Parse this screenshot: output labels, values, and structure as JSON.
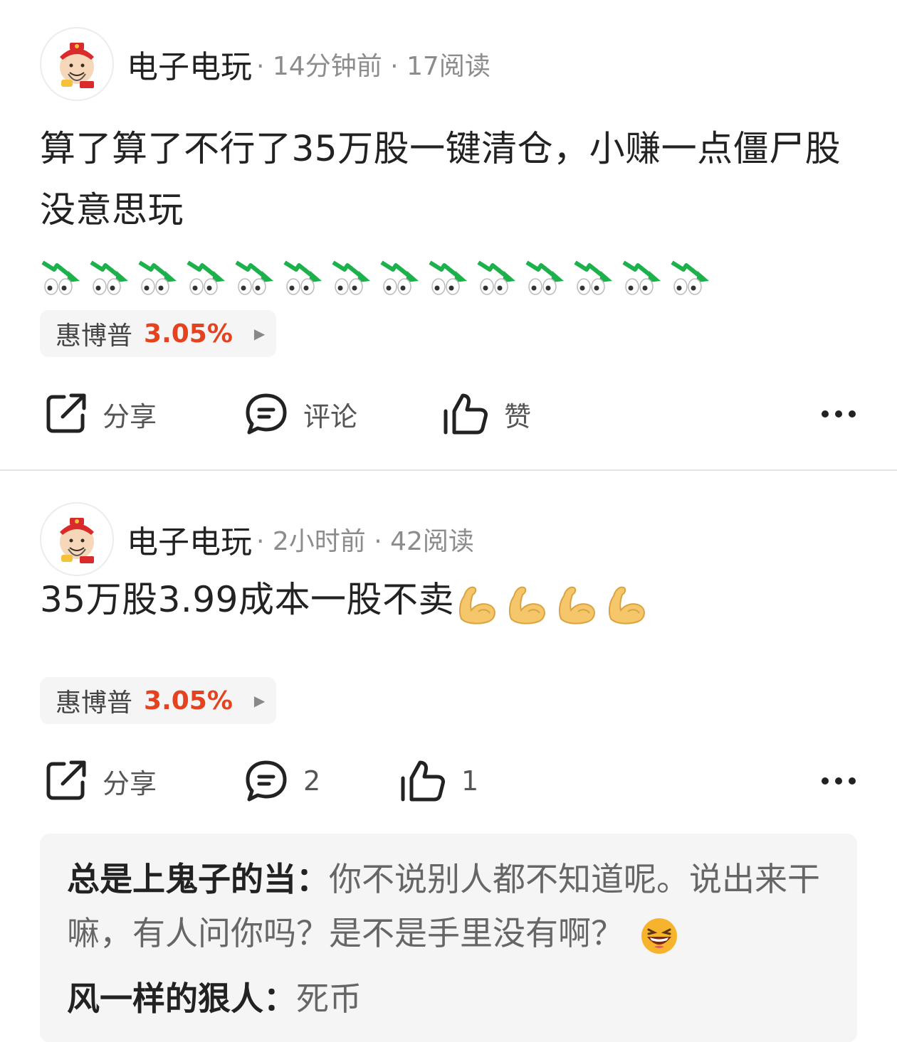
{
  "posts": [
    {
      "author": "电子电玩",
      "meta": "· 14分钟前 · 17阅读",
      "text": "算了算了不行了35万股一键清仓，小赚一点僵尸股没意思玩",
      "emoji_name": "falling-chart-eyes-emoji",
      "emoji_count": 14,
      "stock": {
        "name": "惠博普",
        "change": "3.05%"
      },
      "actions": {
        "share": "分享",
        "comment": "评论",
        "like": "赞"
      }
    },
    {
      "author": "电子电玩",
      "meta": "· 2小时前 · 42阅读",
      "text": "35万股3.99成本一股不卖",
      "emoji_name": "flexed-biceps-emoji",
      "emoji_count": 4,
      "stock": {
        "name": "惠博普",
        "change": "3.05%"
      },
      "actions": {
        "share": "分享",
        "comment": "2",
        "like": "1"
      },
      "comments": [
        {
          "user": "总是上鬼子的当：",
          "text": "你不说别人都不知道呢。说出来干嘛，有人问你吗？是不是手里没有啊？",
          "emoji_name": "laughing-face-emoji"
        },
        {
          "user": "风一样的狠人：",
          "text": "死币"
        }
      ]
    }
  ],
  "colors": {
    "accent_red": "#e5431f",
    "text_primary": "#222222",
    "text_meta": "#8c8c8c",
    "chip_bg": "#f5f5f5",
    "falling_green": "#1bb24b",
    "biceps_yellow": "#f5c66a"
  }
}
